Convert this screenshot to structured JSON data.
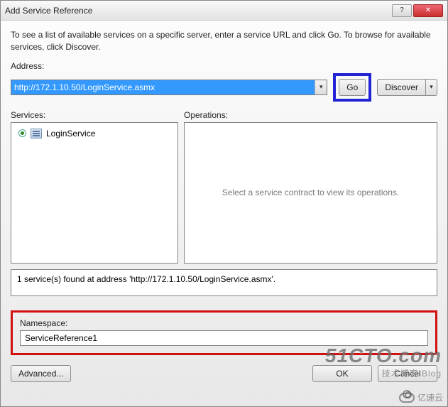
{
  "window": {
    "title": "Add Service Reference",
    "help_btn": "?",
    "close_btn": "✕"
  },
  "intro": "To see a list of available services on a specific server, enter a service URL and click Go. To browse for available services, click Discover.",
  "address": {
    "label": "Address:",
    "value": "http://172.1.10.50/LoginService.asmx"
  },
  "buttons": {
    "go": "Go",
    "discover": "Discover",
    "advanced": "Advanced...",
    "ok": "OK",
    "cancel": "Cancel"
  },
  "panels": {
    "services_label": "Services:",
    "operations_label": "Operations:",
    "operations_placeholder": "Select a service contract to view its operations."
  },
  "services": [
    {
      "name": "LoginService"
    }
  ],
  "status": "1 service(s) found at address 'http://172.1.10.50/LoginService.asmx'.",
  "namespace": {
    "label": "Namespace:",
    "value": "ServiceReference1"
  },
  "watermarks": {
    "w1_main": "51CTO.com",
    "w1_sub": "技术博客  Blog",
    "w2": "亿速云"
  }
}
